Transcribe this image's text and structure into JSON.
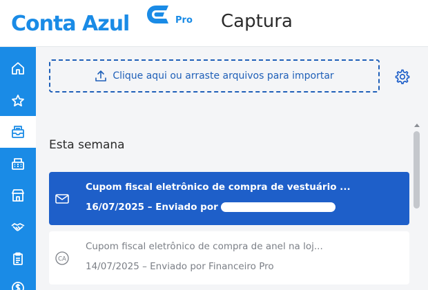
{
  "header": {
    "logo_text": "Conta Azul",
    "logo_pro": "Pro",
    "title": "Captura"
  },
  "sidebar": {
    "items": [
      {
        "icon": "home-icon"
      },
      {
        "icon": "star-icon"
      },
      {
        "icon": "inbox-icon",
        "active": true
      },
      {
        "icon": "cash-register-icon"
      },
      {
        "icon": "store-icon"
      },
      {
        "icon": "handshake-icon"
      },
      {
        "icon": "clipboard-icon"
      },
      {
        "icon": "dollar-icon"
      }
    ]
  },
  "main": {
    "upload_label": "Clique aqui ou arraste arquivos para importar",
    "section_title": "Esta semana",
    "items": [
      {
        "title": "Cupom fiscal eletrônico de compra de vestuário ...",
        "meta": "16/07/2025 – Enviado por",
        "icon": "envelope-icon",
        "selected": true
      },
      {
        "title": "Cupom fiscal eletrônico de compra de anel na loj...",
        "meta": "14/07/2025 – Enviado por Financeiro Pro",
        "icon": "ca-badge-icon",
        "selected": false
      }
    ]
  },
  "colors": {
    "brand": "#1a8be6",
    "selected": "#1e5fc9",
    "upload_border": "#1e5fb8"
  }
}
